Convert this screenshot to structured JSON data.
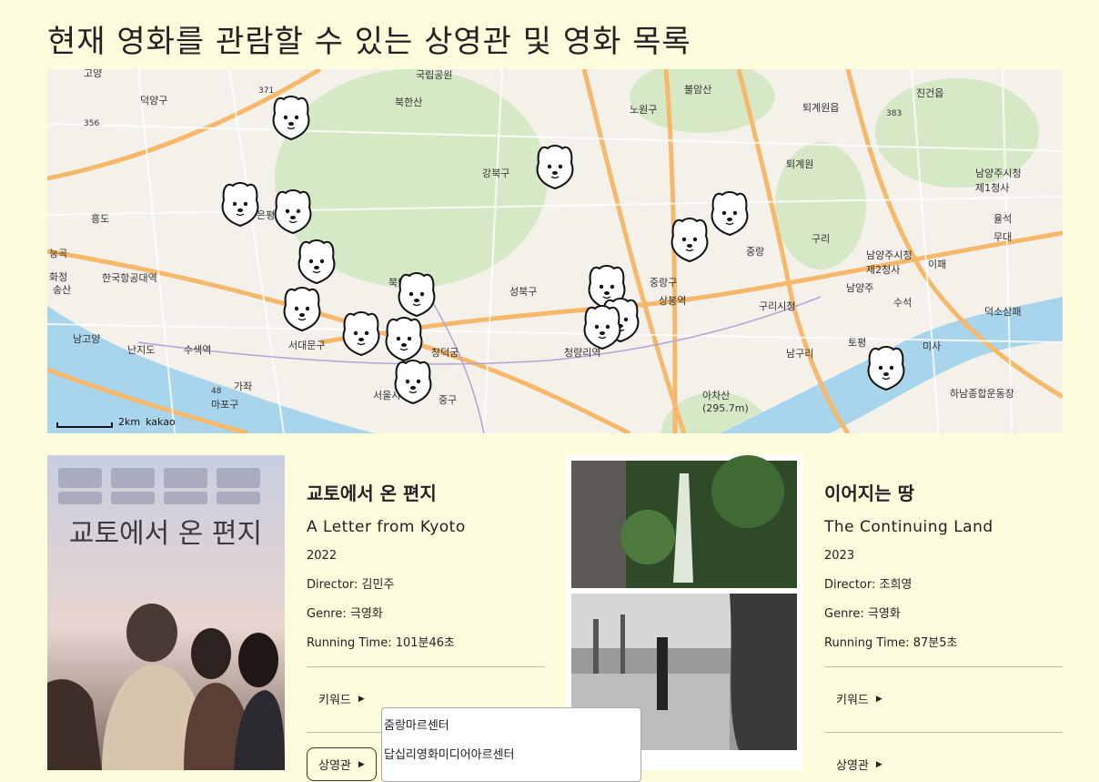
{
  "page": {
    "title": "현재 영화를 관람할 수 있는 상영관 및 영화 목록"
  },
  "map": {
    "scale_label": "2km",
    "brand": "kakao",
    "labels": [
      "고양",
      "덕양구",
      "국립공원",
      "북한산",
      "불암산",
      "진건읍",
      "노원구",
      "퇴계원읍",
      "강북구",
      "퇴계원",
      "남양주시청",
      "제1청사",
      "은평구",
      "중랑",
      "구리",
      "율석",
      "무대",
      "한국항공대역",
      "성북구",
      "중랑구",
      "남양주시청",
      "제2청사",
      "이패",
      "북악산",
      "상봉역",
      "구리시청",
      "남양주",
      "수석",
      "덕소삼패",
      "남고양",
      "난지도",
      "수색역",
      "서대문구",
      "창덕궁",
      "청량리역",
      "남구리",
      "토평",
      "미사",
      "마포구",
      "가좌",
      "서울시청",
      "중구",
      "아차산",
      "(295.7m)",
      "하남종합운동장",
      "흥도",
      "능곡",
      "화정",
      "송산",
      "371",
      "356",
      "383",
      "48"
    ]
  },
  "movies": [
    {
      "ko_title": "교토에서 온 편지",
      "en_title": "A Letter from Kyoto",
      "year": "2022",
      "director": "Director: 김민주",
      "genre": "Genre: 극영화",
      "running_time": "Running Time: 101분46초",
      "keywords_label": "키워드",
      "theaters_label": "상영관",
      "poster_text": "교토에서 온 편지"
    },
    {
      "ko_title": "이어지는 땅",
      "en_title": "The Continuing Land",
      "year": "2023",
      "director": "Director: 조희영",
      "genre": "Genre: 극영화",
      "running_time": "Running Time: 87분5초",
      "keywords_label": "키워드",
      "theaters_label": "상영관"
    }
  ],
  "dropdown": {
    "items": [
      "줌랑마르센터",
      "답십리영화미디어아르센터"
    ]
  },
  "colors": {
    "background": "#fdfcdc",
    "river": "#a8d4ec",
    "road": "#f6b86a",
    "park": "#c6e2b4"
  }
}
